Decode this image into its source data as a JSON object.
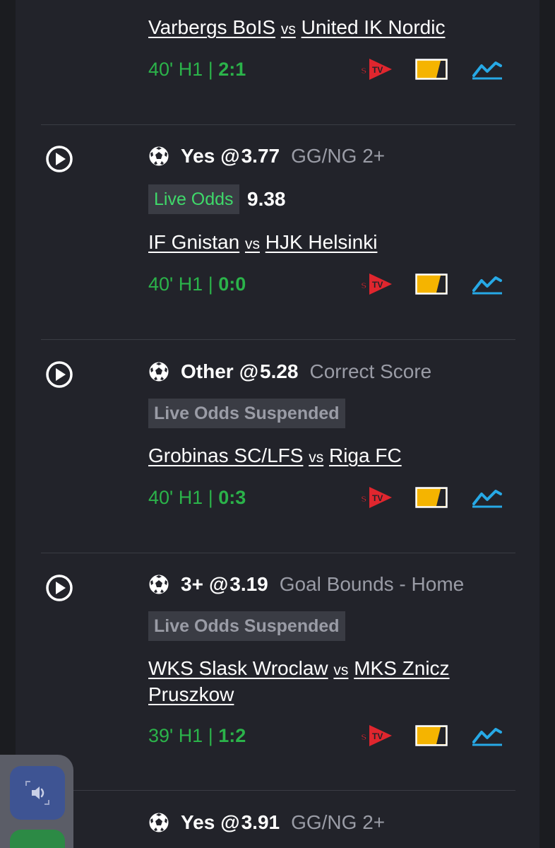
{
  "bets": [
    {
      "id": "bet-0",
      "selection": {
        "pick": "",
        "at": "",
        "odds": "",
        "market": ""
      },
      "live_odds": null,
      "match": {
        "home": "Varbergs BoIS",
        "vs": "vs",
        "away": "United IK Nordic"
      },
      "status": {
        "time": "40' H1 |",
        "score": "2:1"
      }
    },
    {
      "id": "bet-1",
      "selection": {
        "pick": "Yes",
        "at": "@",
        "odds": "3.77",
        "market": "GG/NG 2+"
      },
      "live_odds": {
        "label": "Live Odds",
        "value": "9.38",
        "state": "active"
      },
      "match": {
        "home": "IF Gnistan",
        "vs": "vs",
        "away": "HJK Helsinki"
      },
      "status": {
        "time": "40' H1 |",
        "score": "0:0"
      }
    },
    {
      "id": "bet-2",
      "selection": {
        "pick": "Other",
        "at": "@",
        "odds": "5.28",
        "market": "Correct Score"
      },
      "live_odds": {
        "label": "Live Odds Suspended",
        "value": "",
        "state": "suspended"
      },
      "match": {
        "home": "Grobinas SC/LFS",
        "vs": "vs",
        "away": "Riga FC"
      },
      "status": {
        "time": "40' H1 |",
        "score": "0:3"
      }
    },
    {
      "id": "bet-3",
      "selection": {
        "pick": "3+",
        "at": "@",
        "odds": "3.19",
        "market": "Goal Bounds - Home"
      },
      "live_odds": {
        "label": "Live Odds Suspended",
        "value": "",
        "state": "suspended"
      },
      "match": {
        "home": "WKS Slask Wroclaw",
        "vs": "vs",
        "away": "MKS Znicz Pruszkow"
      },
      "status": {
        "time": "39' H1 |",
        "score": "1:2"
      }
    },
    {
      "id": "bet-4",
      "selection": {
        "pick": "Yes",
        "at": "@",
        "odds": "3.91",
        "market": "GG/NG 2+"
      },
      "live_odds": null,
      "match": null,
      "status": null
    }
  ],
  "icons": {
    "play": "play-circle-icon",
    "ball": "soccer-ball-icon",
    "stv": "stv-stream-icon",
    "match_tracker": "match-tracker-icon",
    "stats": "statistics-chart-icon",
    "speaker": "speaker-icon"
  },
  "colors": {
    "background": "#1b1c20",
    "card": "#22232a",
    "status_green": "#2bb34a",
    "live_green": "#3fd96a",
    "muted": "#9a9ca6",
    "stv_red": "#e0262e",
    "tracker_yellow": "#f5b400",
    "stats_blue": "#27a9e6"
  }
}
